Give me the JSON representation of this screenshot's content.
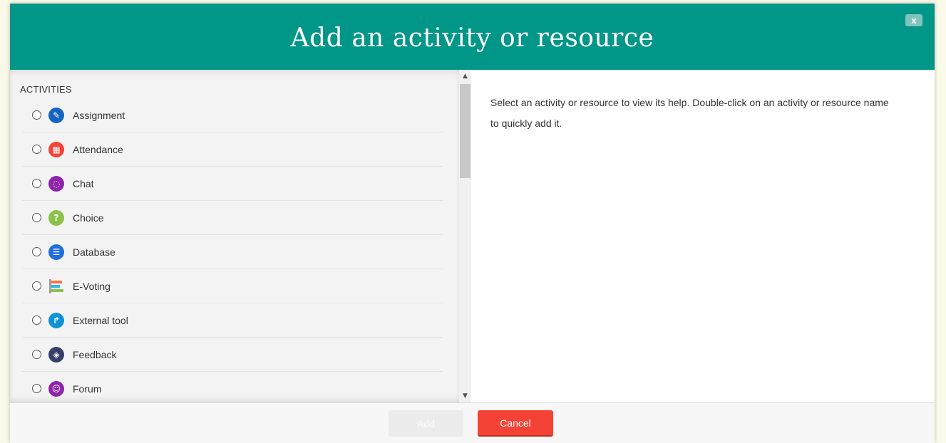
{
  "dialog": {
    "title": "Add an activity or resource",
    "close_label": "x"
  },
  "activities": {
    "heading": "ACTIVITIES",
    "items": [
      {
        "label": "Assignment",
        "icon": "assignment-icon",
        "color": "#1565c0",
        "glyph": "✎"
      },
      {
        "label": "Attendance",
        "icon": "attendance-icon",
        "color": "#f44336",
        "glyph": "▦"
      },
      {
        "label": "Chat",
        "icon": "chat-icon",
        "color": "#8e24aa",
        "glyph": "◌"
      },
      {
        "label": "Choice",
        "icon": "choice-icon",
        "color": "#8bc34a",
        "glyph": "?"
      },
      {
        "label": "Database",
        "icon": "database-icon",
        "color": "#1e6fd9",
        "glyph": "☰"
      },
      {
        "label": "E-Voting",
        "icon": "evoting-icon",
        "color": "#ff7043",
        "glyph": ""
      },
      {
        "label": "External tool",
        "icon": "external-tool-icon",
        "color": "#0d93d6",
        "glyph": "↱"
      },
      {
        "label": "Feedback",
        "icon": "feedback-icon",
        "color": "#37406b",
        "glyph": "◈"
      },
      {
        "label": "Forum",
        "icon": "forum-icon",
        "color": "#8e24aa",
        "glyph": "☺"
      }
    ]
  },
  "help": {
    "text": "Select an activity or resource to view its help. Double-click on an activity or resource name to quickly add it."
  },
  "footer": {
    "add_label": "Add",
    "cancel_label": "Cancel"
  },
  "colors": {
    "header": "#009688",
    "cancel": "#f44336"
  }
}
